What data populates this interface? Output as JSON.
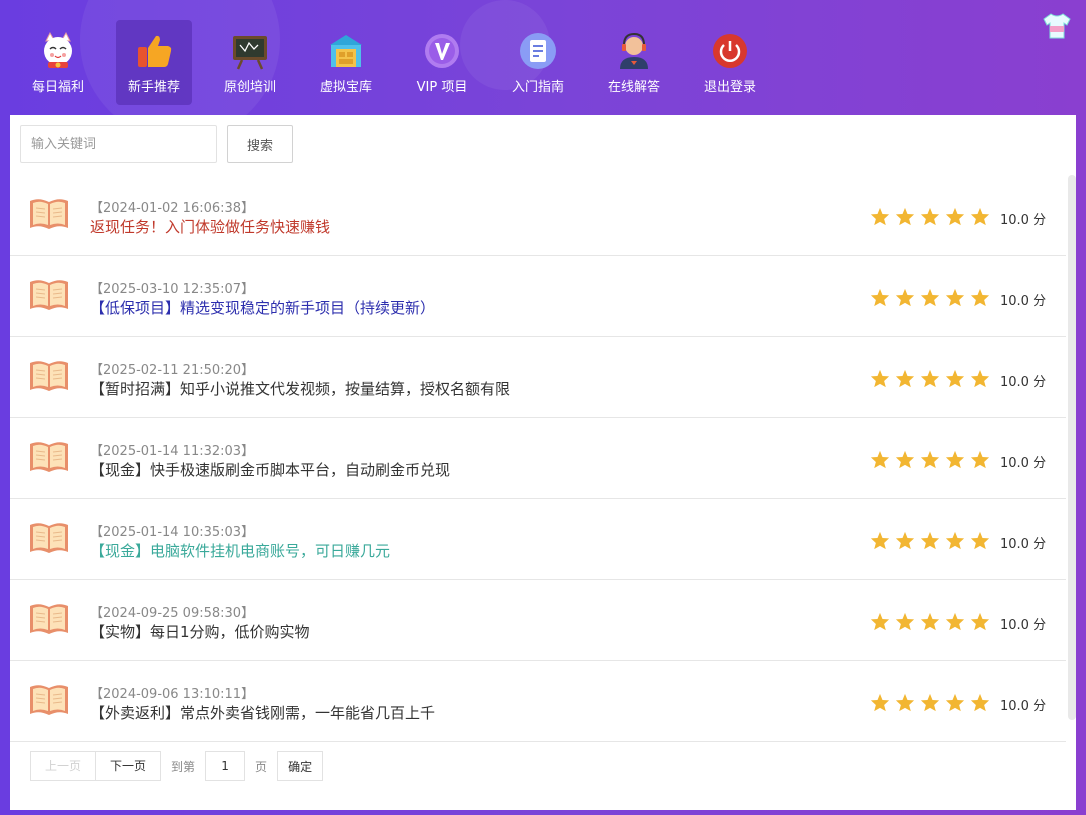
{
  "nav": {
    "items": [
      {
        "label": "每日福利",
        "icon": "lucky-cat-icon"
      },
      {
        "label": "新手推荐",
        "icon": "thumbs-up-icon",
        "active": true
      },
      {
        "label": "原创培训",
        "icon": "blackboard-icon"
      },
      {
        "label": "虚拟宝库",
        "icon": "treasure-vault-icon"
      },
      {
        "label": "VIP 项目",
        "icon": "vip-icon"
      },
      {
        "label": "入门指南",
        "icon": "document-icon"
      },
      {
        "label": "在线解答",
        "icon": "support-agent-icon"
      },
      {
        "label": "退出登录",
        "icon": "power-icon"
      }
    ],
    "skin_icon": "tshirt-icon"
  },
  "search": {
    "placeholder": "输入关键词",
    "button_label": "搜索"
  },
  "list": {
    "rows": [
      {
        "date": "【2024-01-02 16:06:38】",
        "title": "返现任务！入门体验做任务快速赚钱",
        "title_color": "#c0392b",
        "score": "10.0 分"
      },
      {
        "date": "【2025-03-10 12:35:07】",
        "title": "【低保项目】精选变现稳定的新手项目（持续更新）",
        "title_color": "#2d2fae",
        "score": "10.0 分"
      },
      {
        "date": "【2025-02-11 21:50:20】",
        "title": "【暂时招满】知乎小说推文代发视频，按量结算，授权名额有限",
        "title_color": "#333333",
        "score": "10.0 分"
      },
      {
        "date": "【2025-01-14 11:32:03】",
        "title": "【现金】快手极速版刷金币脚本平台，自动刷金币兑现",
        "title_color": "#333333",
        "score": "10.0 分"
      },
      {
        "date": "【2025-01-14 10:35:03】",
        "title": "【现金】电脑软件挂机电商账号，可日赚几元",
        "title_color": "#3aa99a",
        "score": "10.0 分"
      },
      {
        "date": "【2024-09-25 09:58:30】",
        "title": "【实物】每日1分购，低价购实物",
        "title_color": "#333333",
        "score": "10.0 分"
      },
      {
        "date": "【2024-09-06 13:10:11】",
        "title": "【外卖返利】常点外卖省钱刚需，一年能省几百上千",
        "title_color": "#333333",
        "score": "10.0 分"
      }
    ],
    "rating_stars": 5,
    "star_color": "#f2b632",
    "book_icon": "open-book-icon"
  },
  "pager": {
    "prev_label": "上一页",
    "next_label": "下一页",
    "goto_label": "到第",
    "page_value": "1",
    "page_suffix": "页",
    "confirm_label": "确定"
  },
  "colors": {
    "accent": "#7340d8"
  }
}
